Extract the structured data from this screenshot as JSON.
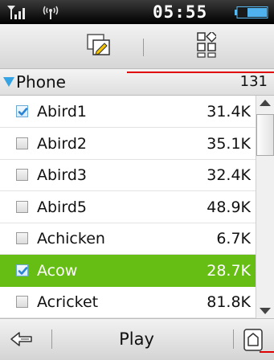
{
  "status": {
    "time": "05:55"
  },
  "folder": {
    "name": "Phone",
    "count": "131"
  },
  "items": [
    {
      "name": "Abird1",
      "size": "31.4K",
      "checked": true,
      "selected": false
    },
    {
      "name": "Abird2",
      "size": "35.1K",
      "checked": false,
      "selected": false
    },
    {
      "name": "Abird3",
      "size": "32.4K",
      "checked": false,
      "selected": false
    },
    {
      "name": "Abird5",
      "size": "48.9K",
      "checked": false,
      "selected": false
    },
    {
      "name": "Achicken",
      "size": "6.7K",
      "checked": false,
      "selected": false
    },
    {
      "name": "Acow",
      "size": "28.7K",
      "checked": true,
      "selected": true
    },
    {
      "name": "Acricket",
      "size": "81.8K",
      "checked": false,
      "selected": false
    }
  ],
  "bottom": {
    "play_label": "Play"
  },
  "colors": {
    "accent_green": "#66bd14",
    "folder_triangle": "#35a3e4",
    "marker_red": "#e00000"
  }
}
